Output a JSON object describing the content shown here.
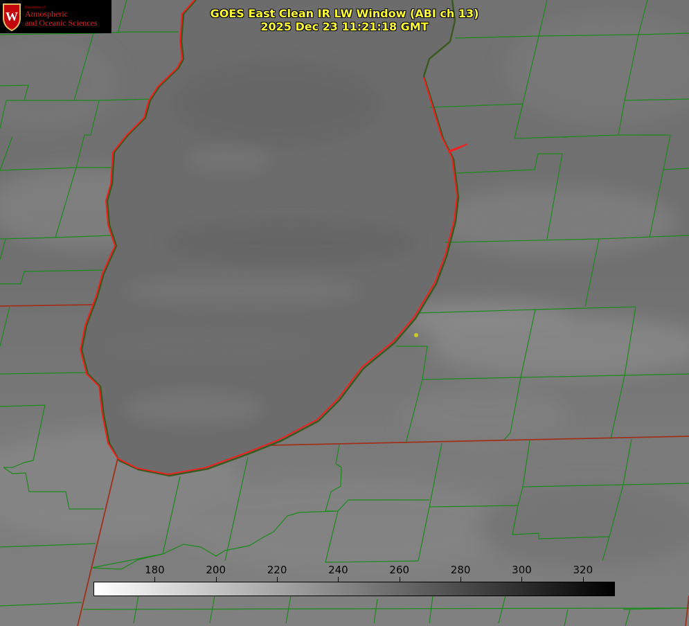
{
  "title": {
    "line1": "GOES East Clean IR LW Window (ABI ch 13)",
    "line2": "2025 Dec 23 11:21:18 GMT"
  },
  "logo": {
    "department": "Department of",
    "line1": "Atmospheric",
    "line2": "and Oceanic Sciences",
    "crest_letter": "W"
  },
  "colorbar": {
    "min": 160,
    "max": 330,
    "ticks": [
      "180",
      "200",
      "220",
      "240",
      "260",
      "280",
      "300",
      "320"
    ],
    "gradient_start": "#ffffff",
    "gradient_end": "#000000"
  },
  "colors": {
    "title_text": "#ffff33",
    "county_lines": "#1a8a1a",
    "state_lines": "#a0301a",
    "lake_outline": "#ff1a1a",
    "marker": "#cccc22",
    "logo_red": "#c5050c"
  },
  "icons": {
    "logo_crest": "uw-crest-icon",
    "location_marker": "location-dot-icon"
  }
}
